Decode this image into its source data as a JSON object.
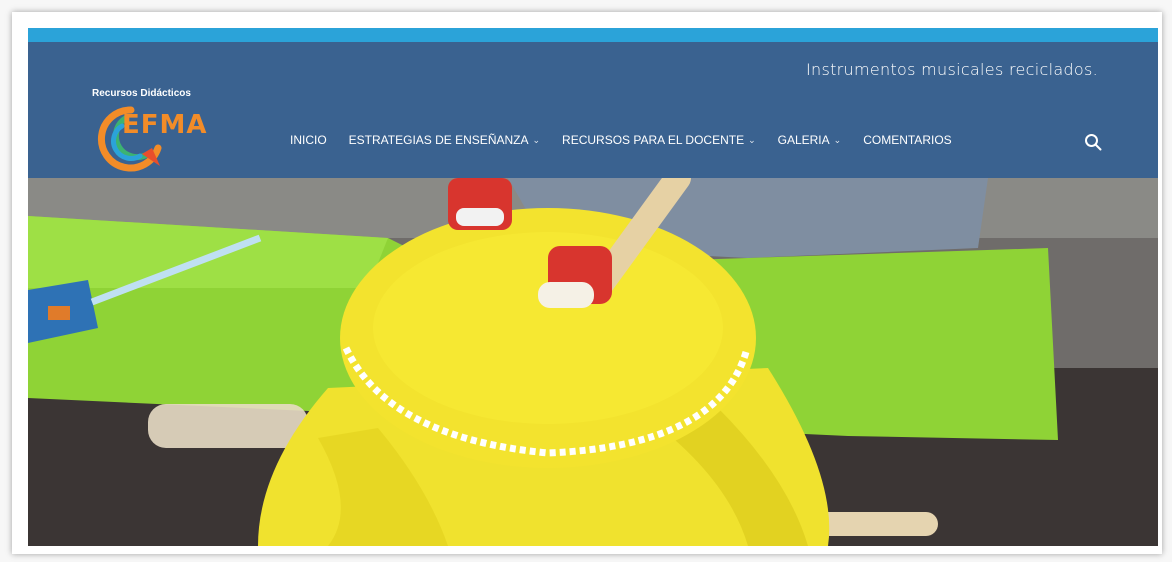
{
  "header": {
    "tagline": "Instrumentos musicales reciclados.",
    "logo_subtitle": "Recursos Didácticos",
    "logo_text": "EFMA"
  },
  "nav": {
    "items": [
      {
        "label": "INICIO",
        "has_dropdown": false
      },
      {
        "label": "ESTRATEGIAS DE ENSEÑANZA",
        "has_dropdown": true
      },
      {
        "label": "RECURSOS PARA EL DOCENTE",
        "has_dropdown": true
      },
      {
        "label": "GALERIA",
        "has_dropdown": true
      },
      {
        "label": "COMENTARIOS",
        "has_dropdown": false
      }
    ],
    "dropdown_icon": "chevron-down-icon",
    "search_icon": "search-icon"
  },
  "colors": {
    "header_bg": "#3a6290",
    "top_bar": "#2ba3d9",
    "text": "#ffffff",
    "logo_orange": "#f28c28"
  }
}
